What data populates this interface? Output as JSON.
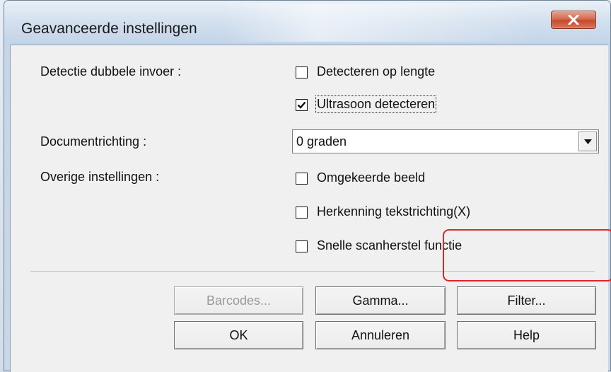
{
  "window": {
    "title": "Geavanceerde instellingen",
    "close_label": "X"
  },
  "double_feed": {
    "label": "Detectie dubbele invoer :",
    "options": [
      {
        "label": "Detecteren op lengte",
        "checked": false
      },
      {
        "label": "Ultrasoon detecteren",
        "checked": true
      }
    ]
  },
  "orientation": {
    "label": "Documentrichting :",
    "value": "0 graden"
  },
  "other": {
    "label": "Overige instellingen :",
    "options": [
      {
        "label": "Omgekeerde beeld",
        "checked": false
      },
      {
        "label": "Herkenning tekstrichting(X)",
        "checked": false
      },
      {
        "label": "Snelle scanherstel functie",
        "checked": false
      }
    ]
  },
  "buttons": {
    "barcodes": "Barcodes...",
    "gamma": "Gamma...",
    "filter": "Filter...",
    "ok": "OK",
    "cancel": "Annuleren",
    "help": "Help"
  },
  "colors": {
    "highlight": "#e0242c",
    "close_button": "#c44a2c"
  }
}
